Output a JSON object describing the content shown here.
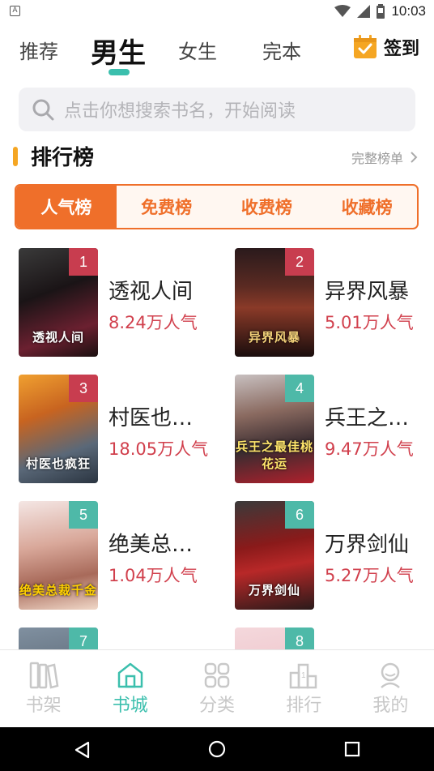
{
  "status_bar": {
    "time": "10:03",
    "notification_letter": "A"
  },
  "header": {
    "tabs": [
      {
        "label": "推荐",
        "active": false
      },
      {
        "label": "男生",
        "active": true
      },
      {
        "label": "女生",
        "active": false
      },
      {
        "label": "完本",
        "active": false
      }
    ],
    "checkin_label": "签到"
  },
  "search": {
    "placeholder": "点击你想搜索书名，开始阅读"
  },
  "ranking": {
    "title": "排行榜",
    "more_label": "完整榜单",
    "tabs": [
      {
        "label": "人气榜",
        "active": true
      },
      {
        "label": "免费榜",
        "active": false
      },
      {
        "label": "收费榜",
        "active": false
      },
      {
        "label": "收藏榜",
        "active": false
      }
    ]
  },
  "books": [
    {
      "rank": "1",
      "name": "透视人间",
      "popularity": "8.24万人气",
      "cover_title": "透视人间"
    },
    {
      "rank": "2",
      "name": "异界风暴",
      "popularity": "5.01万人气",
      "cover_title": "异界风暴"
    },
    {
      "rank": "3",
      "name": "村医也…",
      "popularity": "18.05万人气",
      "cover_title": "村医也疯狂"
    },
    {
      "rank": "4",
      "name": "兵王之…",
      "popularity": "9.47万人气",
      "cover_title": "兵王之最佳桃花运"
    },
    {
      "rank": "5",
      "name": "绝美总…",
      "popularity": "1.04万人气",
      "cover_title": "绝美总裁千金"
    },
    {
      "rank": "6",
      "name": "万界剑仙",
      "popularity": "5.27万人气",
      "cover_title": "万界剑仙"
    },
    {
      "rank": "7",
      "name": "",
      "popularity": "",
      "cover_title": ""
    },
    {
      "rank": "8",
      "name": "",
      "popularity": "",
      "cover_title": ""
    }
  ],
  "bottom_nav": [
    {
      "label": "书架",
      "icon": "bookshelf-icon",
      "active": false
    },
    {
      "label": "书城",
      "icon": "bookstore-icon",
      "active": true
    },
    {
      "label": "分类",
      "icon": "category-icon",
      "active": false
    },
    {
      "label": "排行",
      "icon": "ranking-icon",
      "active": false
    },
    {
      "label": "我的",
      "icon": "profile-icon",
      "active": false
    }
  ],
  "colors": {
    "accent_teal": "#3bbfad",
    "accent_orange": "#ef6f2a",
    "popularity_red": "#d1404d",
    "checkin_orange": "#f5a623"
  }
}
